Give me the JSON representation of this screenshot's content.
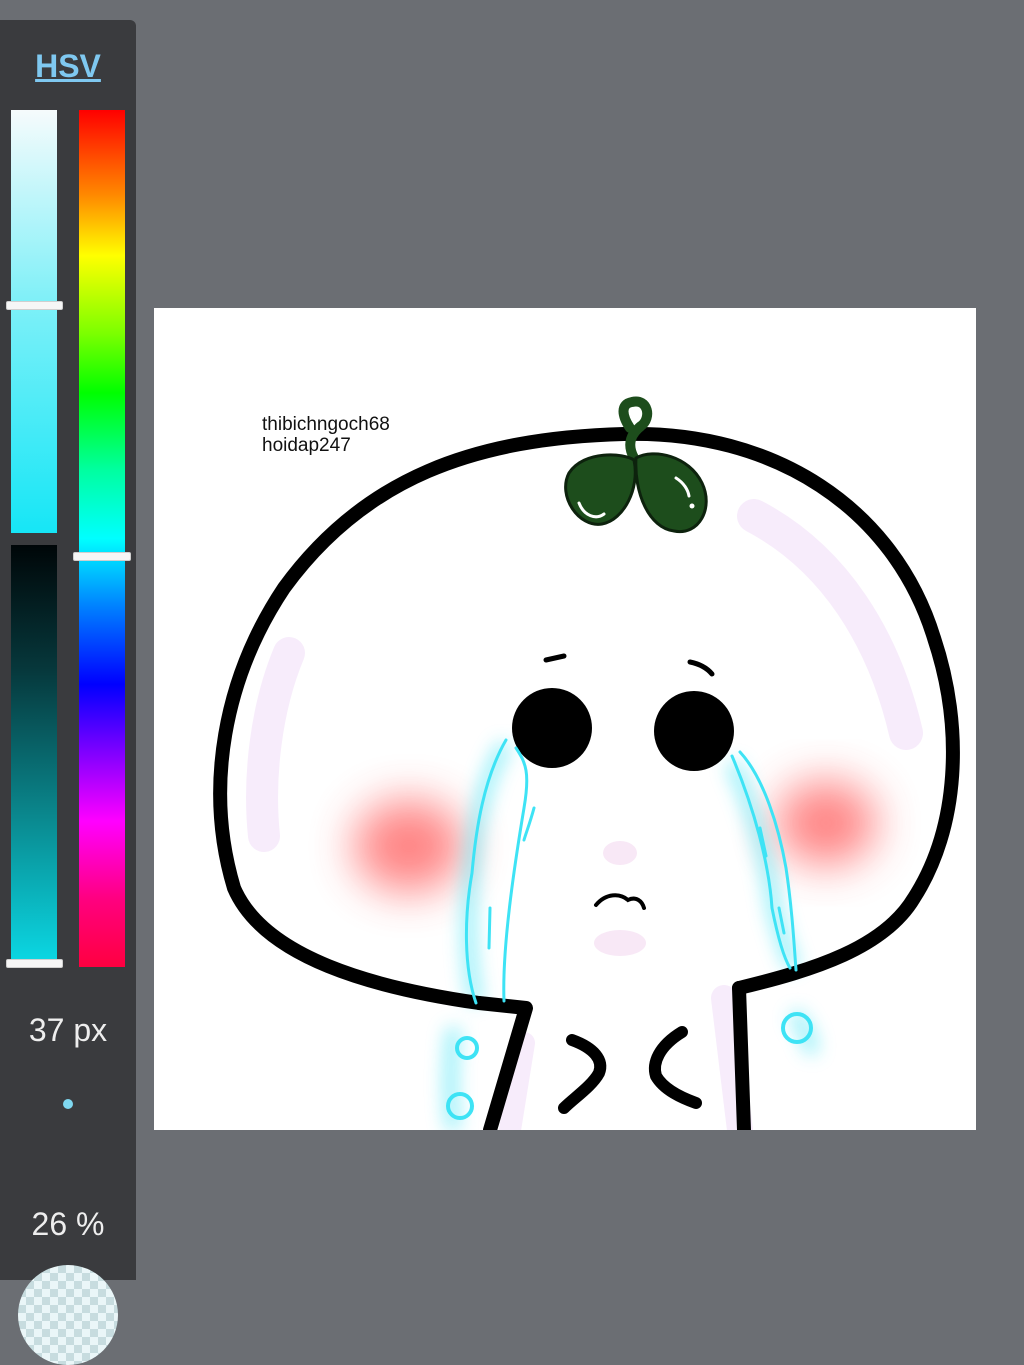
{
  "color_panel": {
    "mode_label": "HSV",
    "saturation_level": 0.46,
    "value_level": 1.0,
    "hue_level": 0.52,
    "brush_size_label": "37 px",
    "opacity_label": "26 %",
    "current_color": "#16e6f6"
  },
  "canvas": {
    "watermark_line1": "thibichngoch68",
    "watermark_line2": "hoidap247",
    "background_color": "#ffffff",
    "outline_color": "#000000",
    "sprout_color": "#1d4d1c",
    "blush_color": "#ff7777",
    "tear_color": "#3ee3f5"
  }
}
